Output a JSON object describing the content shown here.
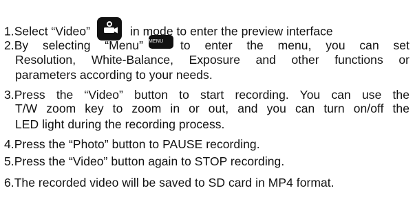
{
  "instructions": {
    "step1": {
      "prefix": "1.Select “Video”",
      "suffix": "in mode to enter the preview interface",
      "icon": "video-camera-icon"
    },
    "step2": {
      "prefix": "2.By selecting “Menu”",
      "button_label": "MENU",
      "line1_suffix": "to enter the menu, you can set",
      "line2": "Resolution, White-Balance, Exposure and other functions or",
      "line3": "parameters according to your needs."
    },
    "step3": {
      "line1": "3.Press the “Video” button to start recording. You can use the",
      "line2": "T/W zoom key to zoom in or out, and you can turn on/off the",
      "line3": "LED light during the recording process."
    },
    "step4": "4.Press the “Photo” button to PAUSE recording.",
    "step5": "5.Press the “Video” button again to STOP recording.",
    "step6": "6.The recorded video will be saved to SD card in MP4 format."
  }
}
